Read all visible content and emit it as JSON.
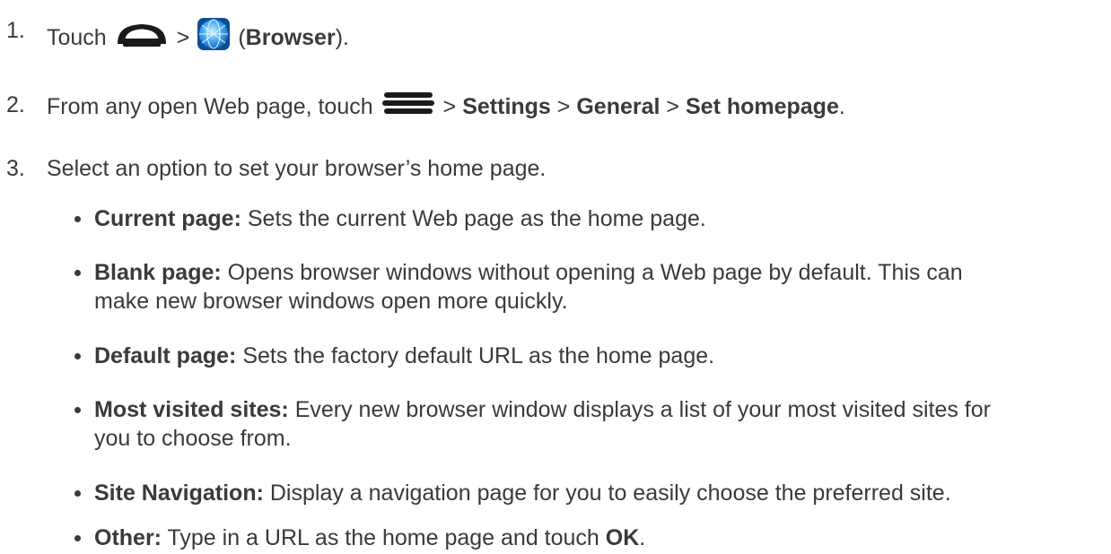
{
  "steps": [
    {
      "number": "1.",
      "pre": "Touch",
      "home_icon": "home-icon",
      "sep": ">",
      "browser_icon": "browser-globe-icon",
      "open_paren": "(",
      "bold": "Browser",
      "close": ")."
    },
    {
      "number": "2.",
      "pre": "From any open Web page, touch",
      "menu_icon": "menu-icon",
      "sep1": ">",
      "b1": "Settings",
      "sep2": ">",
      "b2": "General",
      "sep3": ">",
      "b3": "Set homepage",
      "end": "."
    },
    {
      "number": "3.",
      "text": "Select an option to set your browser’s home page."
    }
  ],
  "options": [
    {
      "label": "Current page:",
      "desc": "Sets the current Web page as the home page."
    },
    {
      "label": "Blank page:",
      "desc": "Opens browser windows without opening a Web page by default. This can",
      "desc2": "make new browser windows open more quickly."
    },
    {
      "label": "Default page:",
      "desc": "Sets the factory default URL as the home page."
    },
    {
      "label": "Most visited sites:",
      "desc": "Every new browser window displays a list of your most visited sites for",
      "desc2": "you to choose from."
    },
    {
      "label": "Site Navigation:",
      "desc": "Display a navigation page for you to easily choose the preferred site."
    },
    {
      "label": "Other:",
      "desc": "Type in a URL as the home page and touch",
      "bold_end": "OK",
      "end": "."
    }
  ]
}
